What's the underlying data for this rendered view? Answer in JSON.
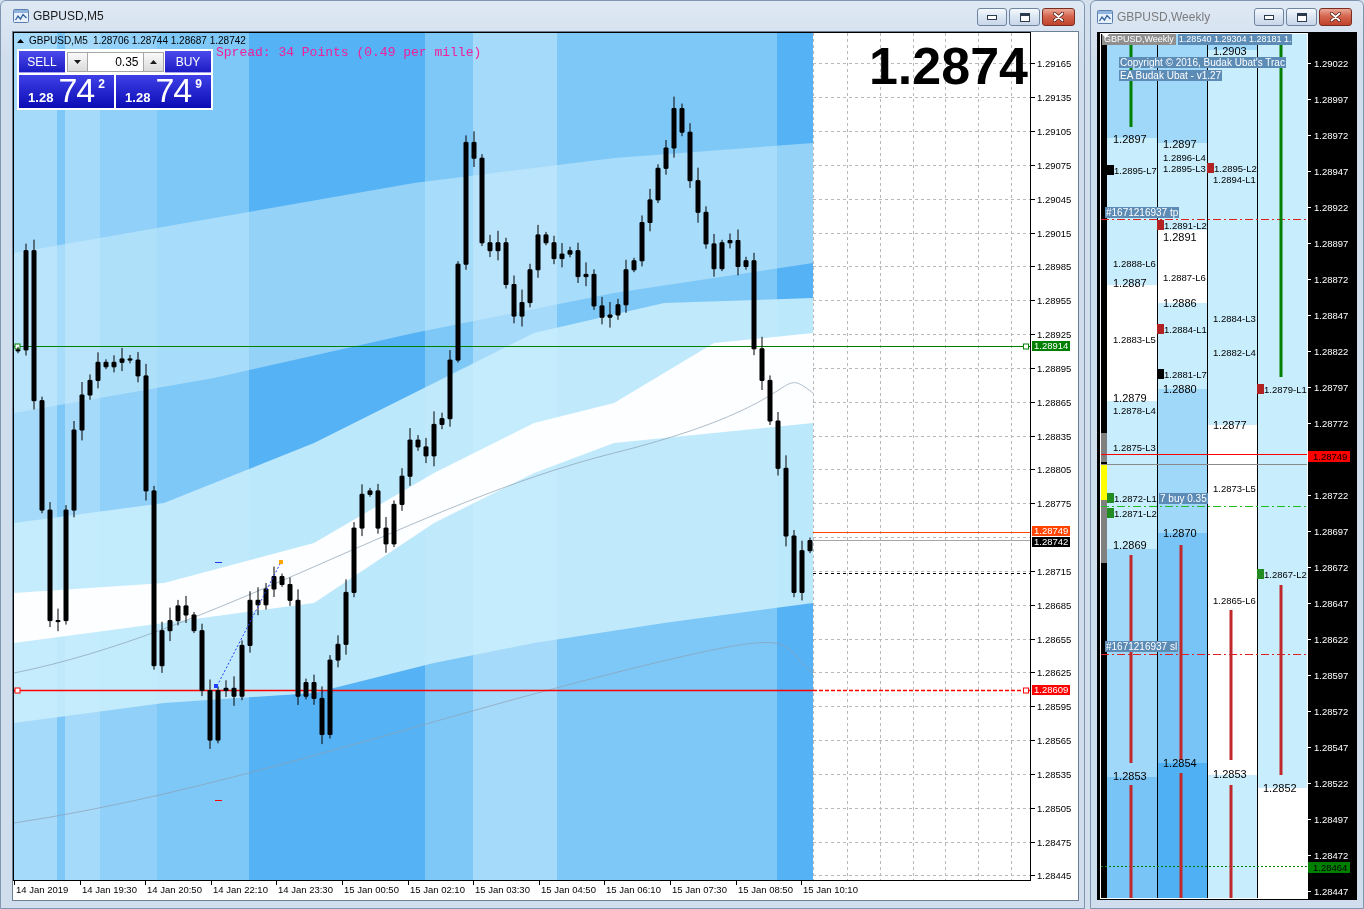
{
  "m5_window": {
    "title": "GBPUSD,M5",
    "active": true,
    "chart": {
      "header": {
        "symbol": "GBPUSD,M5",
        "ohlc": "1.28706 1.28744 1.28687 1.28742"
      },
      "trade_panel": {
        "sell": {
          "label": "SELL",
          "price_prefix": "1.28",
          "price_pips": "74",
          "price_point": "2"
        },
        "volume": "0.35",
        "buy": {
          "label": "BUY",
          "price_prefix": "1.28",
          "price_pips": "74",
          "price_point": "9"
        }
      },
      "spread": "Spread: 34 Points (0.49 per mille)",
      "current_price": "1.2874",
      "price_lines": [
        {
          "label": "1.28914",
          "color": "#008000",
          "kind": "tp"
        },
        {
          "label": "1.28749",
          "color": "#ff4500",
          "kind": "ask"
        },
        {
          "label": "1.28742",
          "color": "#000000",
          "kind": "bid"
        },
        {
          "label": "1.28609",
          "color": "#ff0000",
          "kind": "sl"
        }
      ],
      "price_axis": [
        "1.29165",
        "1.29135",
        "1.29105",
        "1.29075",
        "1.29045",
        "1.29015",
        "1.28985",
        "1.28955",
        "1.28925",
        "1.28895",
        "1.28865",
        "1.28835",
        "1.28805",
        "1.28775",
        "1.28715",
        "1.28685",
        "1.28655",
        "1.28625",
        "1.28595",
        "1.28565",
        "1.28535",
        "1.28505",
        "1.28475",
        "1.28445"
      ],
      "time_axis": [
        "14 Jan 2019",
        "14 Jan 19:30",
        "14 Jan 20:50",
        "14 Jan 22:10",
        "14 Jan 23:30",
        "15 Jan 00:50",
        "15 Jan 02:10",
        "15 Jan 03:30",
        "15 Jan 04:50",
        "15 Jan 06:10",
        "15 Jan 07:30",
        "15 Jan 08:50",
        "15 Jan 10:10"
      ]
    }
  },
  "weekly_window": {
    "title": "GBPUSD,Weekly",
    "active": false,
    "chart": {
      "header": {
        "symbol": "GBPUSD,Weekly",
        "ohlc": "1.28540 1.29304 1.28181 1."
      },
      "copyright": "Copyright © 2016, Budak Ubat's Trac",
      "ea_label": "EA Budak Ubat - v1.27",
      "order_tags": [
        {
          "text": "#1671216937 tp",
          "kind": "tp"
        },
        {
          "text": "7 buy 0.35",
          "kind": "entry"
        },
        {
          "text": "#1671216937 sl",
          "kind": "sl"
        }
      ],
      "columns": [
        {
          "labels": [
            {
              "text": "1.2897",
              "kind": "price"
            },
            {
              "text": "1.2895-L7",
              "kind": "entry",
              "color": "#000000"
            },
            {
              "text": "1.2888-L6",
              "kind": "level"
            },
            {
              "text": "1.2887",
              "kind": "price"
            },
            {
              "text": "1.2883-L5",
              "kind": "level"
            },
            {
              "text": "1.2879",
              "kind": "price"
            },
            {
              "text": "1.2878-L4",
              "kind": "level"
            },
            {
              "text": "1.2875-L3",
              "kind": "level"
            },
            {
              "text": "1.2872-L1",
              "kind": "entry",
              "color": "#228b22"
            },
            {
              "text": "1.2871-L2",
              "kind": "entry",
              "color": "#228b22"
            },
            {
              "text": "1.2869",
              "kind": "price"
            },
            {
              "text": "1.2853",
              "kind": "price"
            }
          ]
        },
        {
          "labels": [
            {
              "text": "1.2897",
              "kind": "price"
            },
            {
              "text": "1.2896-L4",
              "kind": "level"
            },
            {
              "text": "1.2895-L3",
              "kind": "level"
            },
            {
              "text": "1.2891-L2",
              "kind": "entry",
              "color": "#b22222"
            },
            {
              "text": "1.2891",
              "kind": "price"
            },
            {
              "text": "1.2887-L6",
              "kind": "level"
            },
            {
              "text": "1.2886",
              "kind": "price"
            },
            {
              "text": "1.2884-L1",
              "kind": "entry",
              "color": "#b22222"
            },
            {
              "text": "1.2881-L7",
              "kind": "entry",
              "color": "#000000"
            },
            {
              "text": "1.2880",
              "kind": "price"
            },
            {
              "text": "1.2870",
              "kind": "price"
            },
            {
              "text": "1.2854",
              "kind": "price"
            }
          ]
        },
        {
          "labels": [
            {
              "text": "1.2903",
              "kind": "price"
            },
            {
              "text": "1.2895-L2",
              "kind": "entry",
              "color": "#b22222"
            },
            {
              "text": "1.2894-L1",
              "kind": "level"
            },
            {
              "text": "1.2884-L3",
              "kind": "level"
            },
            {
              "text": "1.2882-L4",
              "kind": "level"
            },
            {
              "text": "1.2877",
              "kind": "price"
            },
            {
              "text": "1.2873-L5",
              "kind": "level"
            },
            {
              "text": "1.2865-L6",
              "kind": "level"
            },
            {
              "text": "1.2853",
              "kind": "price"
            }
          ]
        },
        {
          "labels": [
            {
              "text": "1.2879-L1",
              "kind": "entry",
              "color": "#b22222"
            },
            {
              "text": "1.2867-L2",
              "kind": "entry",
              "color": "#228b22"
            },
            {
              "text": "1.2852",
              "kind": "price"
            }
          ]
        }
      ],
      "price_axis": [
        "1.29022",
        "1.28997",
        "1.28972",
        "1.28947",
        "1.28922",
        "1.28897",
        "1.28872",
        "1.28847",
        "1.28822",
        "1.28797",
        "1.28772",
        "1.28722",
        "1.28697",
        "1.28672",
        "1.28647",
        "1.28622",
        "1.28597",
        "1.28572",
        "1.28547",
        "1.28522",
        "1.28497",
        "1.28472",
        "1.28447"
      ],
      "price_lines": [
        {
          "label": "1.28749",
          "color": "#ff0000",
          "kind": "solid"
        },
        {
          "label": "1.28464",
          "color": "#008000",
          "kind": "dotted"
        }
      ]
    }
  }
}
